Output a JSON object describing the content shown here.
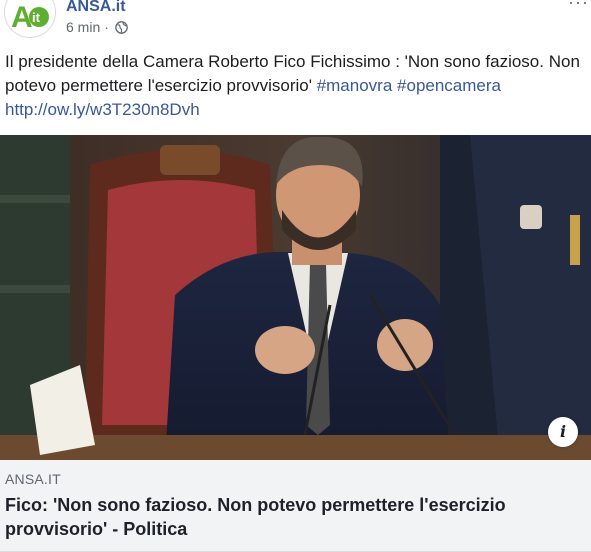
{
  "header": {
    "page_name": "ANSA.it",
    "timestamp": "6 min",
    "meta_separator": "·",
    "more_label": "···",
    "avatar_text": "it",
    "avatar_letter": "A"
  },
  "post": {
    "text_plain": "Il presidente della Camera Roberto Fico Fichissimo : 'Non sono fazioso. Non potevo permettere l'esercizio provvisorio' ",
    "hashtag_1": "#manovra",
    "hashtag_2": "#opencamera",
    "link": "http://ow.ly/w3T230n8Dvh"
  },
  "link_preview": {
    "domain": "ANSA.IT",
    "headline": "Fico: 'Non sono fazioso. Non potevo permettere l'esercizio provvisorio' - Politica",
    "info_label": "i"
  },
  "colors": {
    "link_blue": "#385898",
    "avatar_green": "#5fae32",
    "footer_bg": "#f2f3f5"
  },
  "icons": [
    "globe-icon",
    "more-options-icon",
    "info-icon"
  ]
}
